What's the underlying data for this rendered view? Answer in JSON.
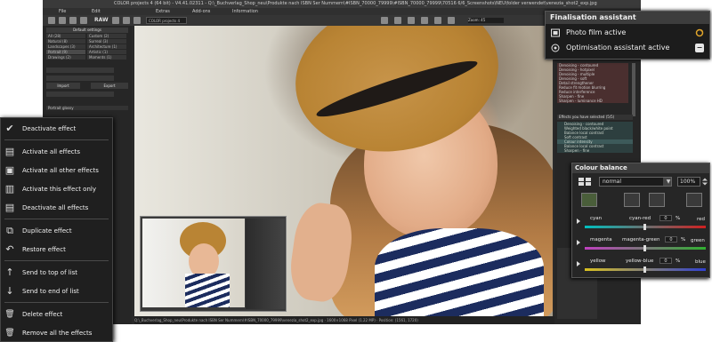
{
  "window": {
    "title": "COLOR projects 4 (64 bit) - V4.41.02311 - Q:\\_Buchverlag_Shop_neu\\Produkte nach ISBN Ser Nummern\\#ISBN_70000_79999\\#ISBN_70000_79999\\70516 6/6_Screenshots\\NEU\\folder verwendet\\venezia_shot2_exp.jpg",
    "menu": [
      "File",
      "Edit",
      "Extras",
      "Add-ons",
      "Information"
    ],
    "raw_label": "RAW",
    "project_select": "COLOR projects 4",
    "zoom": "Zoom: 45"
  },
  "left_panel": {
    "header": "Default settings",
    "presets": [
      "All (28)",
      "Custom (2)",
      "Natural (8)",
      "Surreal (3)",
      "Landscapes (3)",
      "Architecture (1)",
      "Portrait (9)",
      "Artistic (1)",
      "Drawings (2)",
      "Moments (1)"
    ],
    "import_label": "Import",
    "export_label": "Export",
    "preset_title": "Portrait glossy"
  },
  "status_bar": {
    "text": "Q:\\_Buchverlag_Shop_neu\\Produkte nach ISBN Ser Nummern\\#ISBN_70000_79999\\venezia_shot2_exp.jpg  ·  1600×1068 Pixel (1.22 MP)  ·  Position: (1561, 1720)"
  },
  "right_panel": {
    "effect_list": [
      "Denoising - contoured",
      "Denoising - hotpixel",
      "Denoising - multiple",
      "Denoising - soft",
      "Detail strengthener",
      "Reduce fit motion blurring",
      "Reduce interference",
      "Sharpen - fine",
      "Sharpen - luminance HD"
    ],
    "selected_header": "Effects you have selected (5/5)",
    "selected_list": [
      "Denoising - contoured",
      "Weighted black/white point",
      "Balance local contrast",
      "Soft contrast",
      "Colour intensity",
      "Balance local contrast",
      "Sharpen - fine"
    ]
  },
  "finalisation": {
    "title": "Finalisation assistant",
    "rows": [
      {
        "label": "Photo film active"
      },
      {
        "label": "Optimisation assistant active",
        "action": "−"
      }
    ]
  },
  "context_menu": {
    "items": [
      {
        "label": "Deactivate effect",
        "icon": "✔"
      },
      {
        "label": "Activate all effects",
        "icon": "▤"
      },
      {
        "label": "Activate all other effects",
        "icon": "▣"
      },
      {
        "label": "Activate this effect only",
        "icon": "▥"
      },
      {
        "label": "Deactivate all effects",
        "icon": "▤"
      },
      {
        "label": "Duplicate effect",
        "icon": "⧉"
      },
      {
        "label": "Restore effect",
        "icon": "↶"
      },
      {
        "label": "Send to top of list",
        "icon": "↑"
      },
      {
        "label": "Send to end of list",
        "icon": "↓"
      },
      {
        "label": "Delete effect",
        "icon": "🗑"
      },
      {
        "label": "Remove all the effects",
        "icon": "🗑"
      }
    ]
  },
  "color_balance": {
    "title": "Colour balance",
    "mode": "normal",
    "opacity": "100%",
    "rows": [
      {
        "left": "cyan",
        "mid": "cyan-red",
        "value": "0",
        "unit": "%",
        "right": "red",
        "gradient": [
          "#00bfbf",
          "#d02020"
        ]
      },
      {
        "left": "magenta",
        "mid": "magenta-green",
        "value": "0",
        "unit": "%",
        "right": "green",
        "gradient": [
          "#c040c0",
          "#30b030"
        ]
      },
      {
        "left": "yellow",
        "mid": "yellow-blue",
        "value": "0",
        "unit": "%",
        "right": "blue",
        "gradient": [
          "#d8c020",
          "#3040d0"
        ]
      }
    ]
  }
}
